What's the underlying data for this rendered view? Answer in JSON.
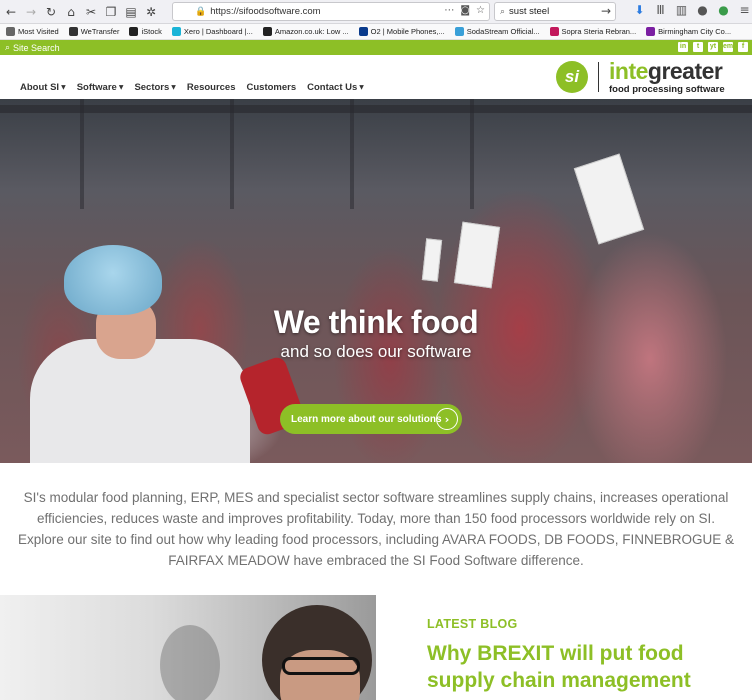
{
  "browser": {
    "url": "https://sifoodsoftware.com",
    "search_value": "sust steel",
    "bookmarks": [
      {
        "label": "Most Visited",
        "icon": "gear-icon",
        "color": "#666666"
      },
      {
        "label": "WeTransfer",
        "icon": "wetransfer-icon",
        "color": "#333333"
      },
      {
        "label": "iStock",
        "icon": "istock-icon",
        "color": "#222222"
      },
      {
        "label": "Xero | Dashboard |...",
        "icon": "xero-icon",
        "color": "#1ab4d7"
      },
      {
        "label": "Amazon.co.uk: Low ...",
        "icon": "amazon-icon",
        "color": "#222222"
      },
      {
        "label": "O2 | Mobile Phones,...",
        "icon": "o2-icon",
        "color": "#0a3b8c"
      },
      {
        "label": "SodaStream Official...",
        "icon": "sodastream-icon",
        "color": "#3aa0d8"
      },
      {
        "label": "Sopra Steria Rebran...",
        "icon": "sopra-icon",
        "color": "#c2185b"
      },
      {
        "label": "Birmingham City Co...",
        "icon": "heart-icon",
        "color": "#7b1fa2"
      }
    ]
  },
  "site": {
    "accent": "#8dbf26",
    "search_label": "Site Search",
    "social": [
      "in",
      "t",
      "yt",
      "em",
      "f"
    ],
    "nav": [
      {
        "label": "About SI",
        "has_caret": true
      },
      {
        "label": "Software",
        "has_caret": true
      },
      {
        "label": "Sectors",
        "has_caret": true
      },
      {
        "label": "Resources",
        "has_caret": false
      },
      {
        "label": "Customers",
        "has_caret": false
      },
      {
        "label": "Contact Us",
        "has_caret": true
      }
    ],
    "logo": {
      "mark": "si",
      "name_green": "inte",
      "name_dark": "greater",
      "tagline": "food processing software"
    },
    "hero": {
      "title": "We think food",
      "subtitle": "and so does our software",
      "cta": "Learn more about our solutions"
    },
    "intro": "SI's modular food planning, ERP, MES and specialist sector software streamlines supply chains, increases operational efficiencies, reduces waste and improves profitability. Today, more than 150 food processors worldwide rely on SI. Explore our site to find out how why leading food processors, including AVARA FOODS, DB FOODS, FINNEBROGUE & FAIRFAX MEADOW have embraced the SI Food Software difference.",
    "blog": {
      "label": "LATEST BLOG",
      "title": "Why BREXIT will put food supply chain management"
    }
  }
}
